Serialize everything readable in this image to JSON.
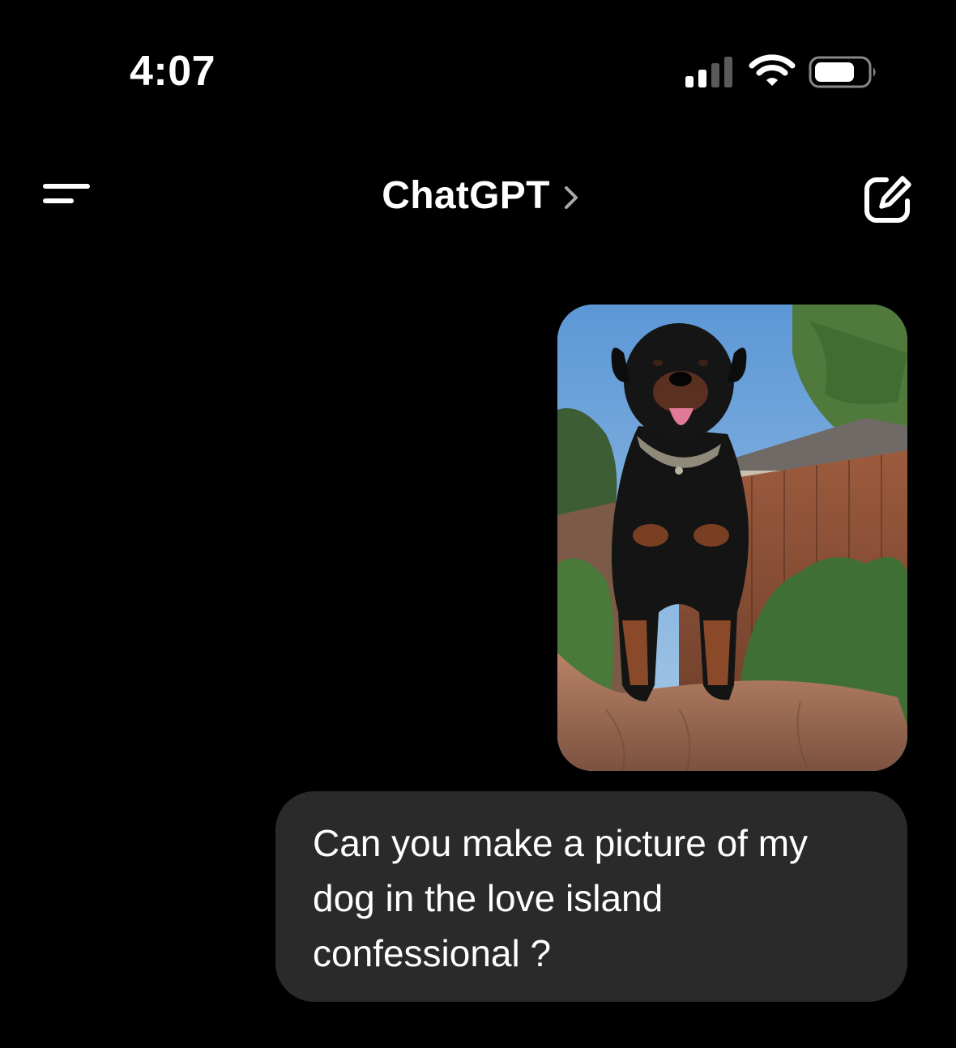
{
  "status_bar": {
    "time": "4:07",
    "icons": [
      "cellular-signal-icon",
      "wifi-icon",
      "battery-icon"
    ]
  },
  "header": {
    "title": "ChatGPT",
    "left_icon": "menu-icon",
    "title_icon": "chevron-right-icon",
    "right_icon": "compose-icon"
  },
  "conversation": {
    "messages": [
      {
        "role": "user",
        "type": "image"
      },
      {
        "role": "user",
        "type": "text",
        "text": "Can you make a picture of my dog in the love island confessional ?"
      }
    ]
  },
  "colors": {
    "background": "#000000",
    "text": "#ffffff",
    "user_bubble": "#2a2a2a"
  }
}
